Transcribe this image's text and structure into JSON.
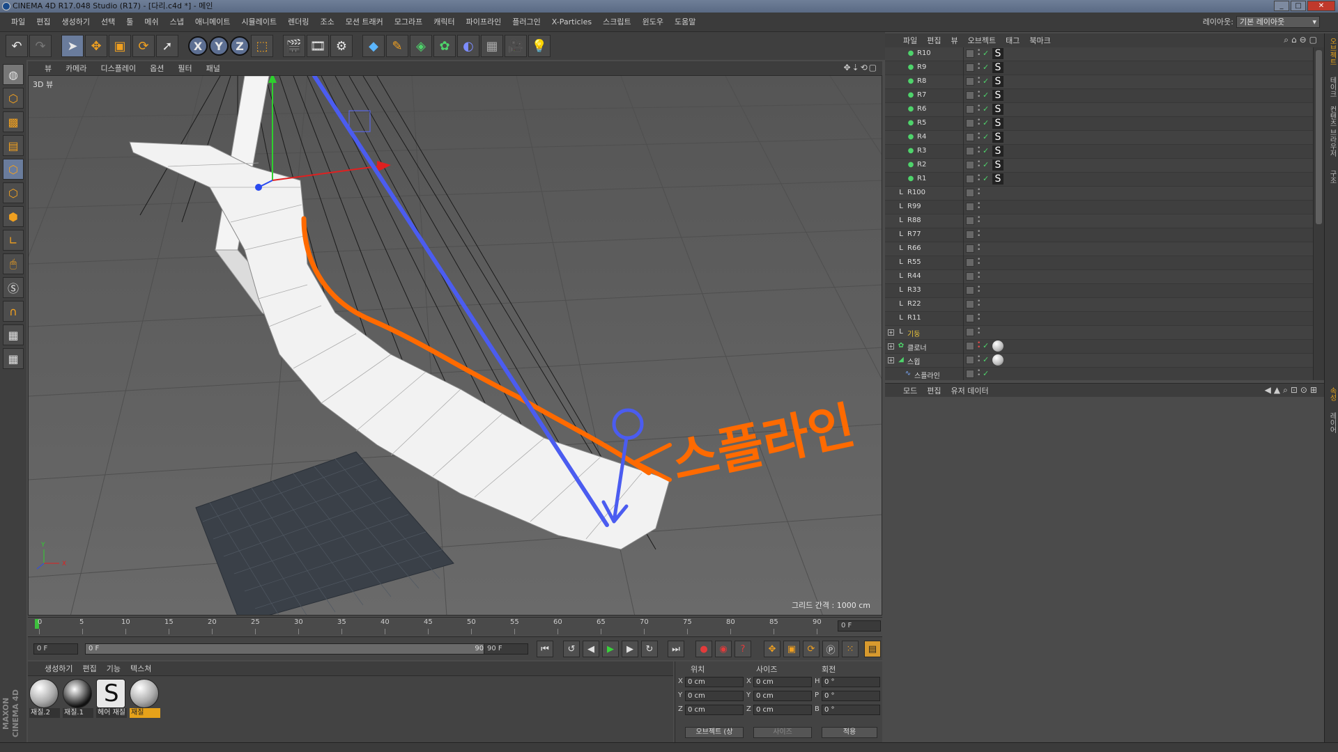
{
  "window": {
    "title": "CINEMA 4D R17.048 Studio (R17) - [다리.c4d *] - 메인",
    "buttons": [
      "_",
      "□",
      "✕"
    ]
  },
  "menubar": {
    "items": [
      "파일",
      "편집",
      "생성하기",
      "선택",
      "툴",
      "메쉬",
      "스냅",
      "애니메이트",
      "시뮬레이트",
      "렌더링",
      "조소",
      "모션 트래커",
      "모그라프",
      "캐릭터",
      "파이프라인",
      "플러그인",
      "X-Particles",
      "스크립트",
      "윈도우",
      "도움말"
    ],
    "layout_label": "레이아웃:",
    "layout_value": "기본 레이아웃"
  },
  "viewport": {
    "menu": [
      "뷰",
      "카메라",
      "디스플레이",
      "옵션",
      "필터",
      "패널"
    ],
    "label": "3D 뷰",
    "grid_spacing": "그리드 간격 : 1000 cm",
    "annotation": "스플라인",
    "axis_labels": [
      "Y",
      "X"
    ]
  },
  "timeline": {
    "ticks": [
      "0",
      "5",
      "10",
      "15",
      "20",
      "25",
      "30",
      "35",
      "40",
      "45",
      "50",
      "55",
      "60",
      "65",
      "70",
      "75",
      "80",
      "85",
      "90"
    ],
    "current_frame": "0 F"
  },
  "transport": {
    "start": "0 F",
    "range_start": "0 F",
    "range_end": "90 F",
    "end": "90 F"
  },
  "materials": {
    "menu": [
      "생성하기",
      "편집",
      "기능",
      "텍스쳐"
    ],
    "items": [
      {
        "label": "재질.2"
      },
      {
        "label": "재질.1"
      },
      {
        "label": "헤어 재질"
      },
      {
        "label": "재질",
        "selected": true
      }
    ]
  },
  "coordinates": {
    "headers": [
      "위치",
      "사이즈",
      "회전"
    ],
    "rows": [
      {
        "a": "X",
        "pos": "0 cm",
        "b": "X",
        "size": "0 cm",
        "c": "H",
        "rot": "0 °"
      },
      {
        "a": "Y",
        "pos": "0 cm",
        "b": "Y",
        "size": "0 cm",
        "c": "P",
        "rot": "0 °"
      },
      {
        "a": "Z",
        "pos": "0 cm",
        "b": "Z",
        "size": "0 cm",
        "c": "B",
        "rot": "0 °"
      }
    ],
    "mode_select": "오브젝트 (상",
    "size_select": "사이즈",
    "apply": "적용"
  },
  "object_manager": {
    "menu": [
      "파일",
      "편집",
      "뷰",
      "오브젝트",
      "태그",
      "북마크"
    ],
    "rows": [
      {
        "name": "R10",
        "type": "child",
        "tag": "hair"
      },
      {
        "name": "R9",
        "type": "child",
        "tag": "hair"
      },
      {
        "name": "R8",
        "type": "child",
        "tag": "hair"
      },
      {
        "name": "R7",
        "type": "child",
        "tag": "hair"
      },
      {
        "name": "R6",
        "type": "child",
        "tag": "hair"
      },
      {
        "name": "R5",
        "type": "child",
        "tag": "hair"
      },
      {
        "name": "R4",
        "type": "child",
        "tag": "hair"
      },
      {
        "name": "R3",
        "type": "child",
        "tag": "hair"
      },
      {
        "name": "R2",
        "type": "child",
        "tag": "hair"
      },
      {
        "name": "R1",
        "type": "child",
        "tag": "hair"
      },
      {
        "name": "R100",
        "type": "null"
      },
      {
        "name": "R99",
        "type": "null"
      },
      {
        "name": "R88",
        "type": "null"
      },
      {
        "name": "R77",
        "type": "null"
      },
      {
        "name": "R66",
        "type": "null"
      },
      {
        "name": "R55",
        "type": "null"
      },
      {
        "name": "R44",
        "type": "null"
      },
      {
        "name": "R33",
        "type": "null"
      },
      {
        "name": "R22",
        "type": "null"
      },
      {
        "name": "R11",
        "type": "null"
      },
      {
        "name": "기둥",
        "type": "group",
        "color": "yellow"
      },
      {
        "name": "클로너",
        "type": "group",
        "tag": "ball"
      },
      {
        "name": "스윕",
        "type": "group",
        "tag": "ball"
      },
      {
        "name": "스플라인",
        "type": "spline"
      }
    ]
  },
  "attribute_manager": {
    "menu": [
      "모드",
      "편집",
      "유저 데이터"
    ]
  },
  "right_tabs": [
    "오브젝트",
    "테이크",
    "컨텐츠 브라우저",
    "구조",
    "속성",
    "레이어"
  ],
  "colors": {
    "annotation_orange": "#ff6a00",
    "annotation_blue": "#4b5cf0",
    "accent": "#e6a21a"
  }
}
